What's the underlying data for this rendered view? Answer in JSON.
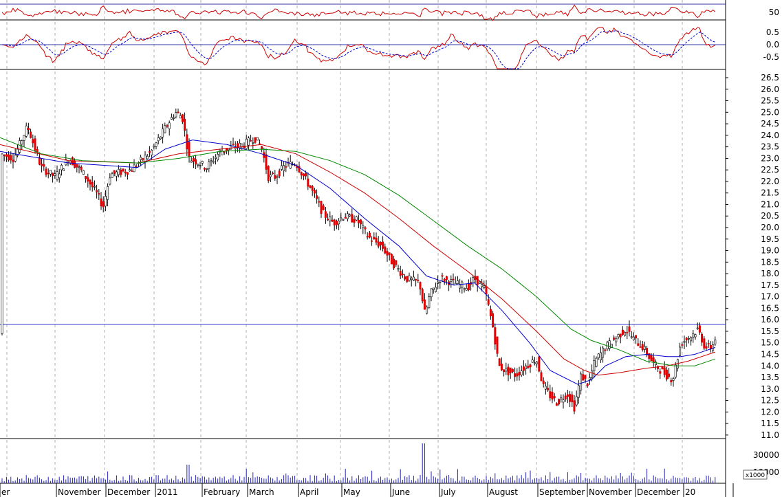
{
  "chart_data": {
    "type": "candlestick",
    "x_labels": [
      "er",
      "November",
      "December",
      "2011",
      "February",
      "March",
      "April",
      "May",
      "June",
      "July",
      "August",
      "September",
      "November",
      "December",
      "20"
    ],
    "price_axis": {
      "ylim": [
        10.7,
        26.9
      ],
      "ticks": [
        "26.5",
        "26.0",
        "25.5",
        "25.0",
        "24.5",
        "24.0",
        "23.5",
        "23.0",
        "22.5",
        "22.0",
        "21.5",
        "21.0",
        "20.5",
        "20.0",
        "19.5",
        "19.0",
        "18.5",
        "18.0",
        "17.5",
        "17.0",
        "16.5",
        "16.0",
        "15.5",
        "15.0",
        "14.5",
        "14.0",
        "13.5",
        "13.0",
        "12.5",
        "12.0",
        "11.5",
        "11.0"
      ],
      "horizontal_line": 15.8
    },
    "rsi_panel": {
      "ticks": [
        "50"
      ],
      "band_upper": 70,
      "band_lower": 30
    },
    "macd_panel": {
      "ticks": [
        "0.5",
        "0.0",
        "-0.5"
      ],
      "zero_line": 0.0
    },
    "volume_panel": {
      "ticks": [
        "30000",
        "10000"
      ],
      "unit_label": "x1000"
    },
    "price_keypoints": [
      [
        0,
        23.2
      ],
      [
        20,
        23.0
      ],
      [
        40,
        24.4
      ],
      [
        60,
        22.6
      ],
      [
        80,
        22.2
      ],
      [
        100,
        23.0
      ],
      [
        120,
        22.4
      ],
      [
        140,
        21.5
      ],
      [
        150,
        20.9
      ],
      [
        160,
        22.3
      ],
      [
        190,
        22.5
      ],
      [
        220,
        23.3
      ],
      [
        240,
        24.3
      ],
      [
        255,
        25.0
      ],
      [
        265,
        24.8
      ],
      [
        275,
        23.0
      ],
      [
        290,
        22.8
      ],
      [
        300,
        22.6
      ],
      [
        320,
        23.3
      ],
      [
        340,
        23.5
      ],
      [
        355,
        23.6
      ],
      [
        370,
        23.9
      ],
      [
        380,
        23.5
      ],
      [
        390,
        22.2
      ],
      [
        400,
        22.2
      ],
      [
        415,
        22.7
      ],
      [
        430,
        22.8
      ],
      [
        450,
        21.8
      ],
      [
        470,
        20.6
      ],
      [
        485,
        20.2
      ],
      [
        500,
        20.5
      ],
      [
        520,
        20.3
      ],
      [
        535,
        19.6
      ],
      [
        555,
        19.2
      ],
      [
        570,
        18.5
      ],
      [
        590,
        17.8
      ],
      [
        610,
        17.6
      ],
      [
        618,
        16.2
      ],
      [
        625,
        17.1
      ],
      [
        640,
        17.8
      ],
      [
        660,
        17.6
      ],
      [
        680,
        17.4
      ],
      [
        690,
        17.8
      ],
      [
        705,
        17.3
      ],
      [
        718,
        15.5
      ],
      [
        725,
        14.0
      ],
      [
        735,
        13.8
      ],
      [
        750,
        13.6
      ],
      [
        765,
        14.0
      ],
      [
        780,
        14.3
      ],
      [
        790,
        13.1
      ],
      [
        800,
        12.7
      ],
      [
        810,
        12.4
      ],
      [
        825,
        12.8
      ],
      [
        835,
        12.2
      ],
      [
        845,
        13.6
      ],
      [
        855,
        13.2
      ],
      [
        865,
        14.2
      ],
      [
        880,
        14.8
      ],
      [
        895,
        15.2
      ],
      [
        910,
        15.6
      ],
      [
        920,
        15.2
      ],
      [
        935,
        14.8
      ],
      [
        950,
        14.1
      ],
      [
        965,
        13.7
      ],
      [
        978,
        13.4
      ],
      [
        990,
        15.0
      ],
      [
        1005,
        15.3
      ],
      [
        1015,
        15.6
      ],
      [
        1025,
        14.8
      ],
      [
        1035,
        14.8
      ],
      [
        1042,
        15.4
      ]
    ],
    "series": [
      {
        "name": "",
        "color": "#0000cc",
        "values": [
          [
            0,
            23.3
          ],
          [
            100,
            22.8
          ],
          [
            200,
            22.6
          ],
          [
            240,
            23.4
          ],
          [
            280,
            23.8
          ],
          [
            330,
            23.6
          ],
          [
            380,
            23.2
          ],
          [
            430,
            22.7
          ],
          [
            480,
            21.7
          ],
          [
            530,
            20.4
          ],
          [
            580,
            19.2
          ],
          [
            620,
            17.9
          ],
          [
            660,
            17.5
          ],
          [
            690,
            17.6
          ],
          [
            730,
            16.4
          ],
          [
            770,
            15.0
          ],
          [
            800,
            13.8
          ],
          [
            840,
            13.2
          ],
          [
            860,
            13.4
          ],
          [
            880,
            14.0
          ],
          [
            910,
            14.4
          ],
          [
            940,
            14.5
          ],
          [
            970,
            14.4
          ],
          [
            990,
            14.4
          ],
          [
            1010,
            14.5
          ],
          [
            1040,
            14.8
          ]
        ]
      },
      {
        "name": "",
        "color": "#cc0000",
        "values": [
          [
            0,
            23.6
          ],
          [
            100,
            22.9
          ],
          [
            200,
            22.8
          ],
          [
            260,
            23.2
          ],
          [
            320,
            23.4
          ],
          [
            380,
            23.6
          ],
          [
            430,
            23.2
          ],
          [
            480,
            22.4
          ],
          [
            530,
            21.5
          ],
          [
            580,
            20.4
          ],
          [
            630,
            19.2
          ],
          [
            680,
            18.1
          ],
          [
            730,
            16.9
          ],
          [
            780,
            15.5
          ],
          [
            820,
            14.3
          ],
          [
            850,
            13.8
          ],
          [
            870,
            13.6
          ],
          [
            900,
            13.7
          ],
          [
            940,
            13.9
          ],
          [
            970,
            14.0
          ],
          [
            1000,
            14.2
          ],
          [
            1040,
            14.6
          ]
        ]
      },
      {
        "name": "",
        "color": "#008800",
        "values": [
          [
            0,
            23.9
          ],
          [
            60,
            23.2
          ],
          [
            120,
            22.9
          ],
          [
            200,
            22.8
          ],
          [
            260,
            23.0
          ],
          [
            320,
            23.3
          ],
          [
            380,
            23.4
          ],
          [
            430,
            23.3
          ],
          [
            480,
            22.9
          ],
          [
            530,
            22.3
          ],
          [
            580,
            21.4
          ],
          [
            630,
            20.3
          ],
          [
            680,
            19.2
          ],
          [
            730,
            18.2
          ],
          [
            780,
            17.0
          ],
          [
            830,
            15.6
          ],
          [
            860,
            15.1
          ],
          [
            900,
            14.7
          ],
          [
            940,
            14.2
          ],
          [
            980,
            14.0
          ],
          [
            1010,
            14.0
          ],
          [
            1040,
            14.3
          ]
        ]
      }
    ],
    "grid": true
  }
}
